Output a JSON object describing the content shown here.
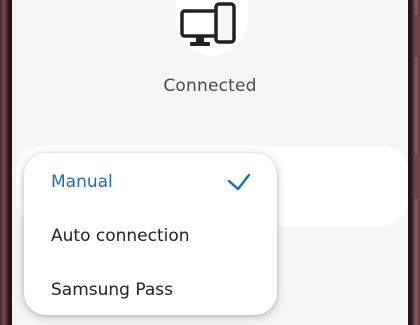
{
  "status": {
    "label": "Connected"
  },
  "menu": {
    "items": [
      {
        "label": "Manual",
        "selected": true
      },
      {
        "label": "Auto connection",
        "selected": false
      },
      {
        "label": "Samsung Pass",
        "selected": false
      }
    ]
  },
  "icons": {
    "device": "pc-and-phone-icon",
    "selected": "checkmark-icon"
  },
  "colors": {
    "accent": "#1a6fb5",
    "text": "#222222",
    "status_text": "#4a4a4a",
    "background": "#f6f6f6",
    "surface": "#ffffff"
  }
}
